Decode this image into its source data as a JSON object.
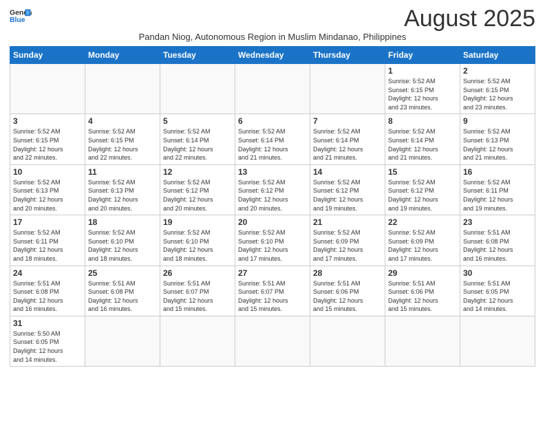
{
  "header": {
    "logo_line1": "General",
    "logo_line2": "Blue",
    "month_title": "August 2025",
    "subtitle": "Pandan Niog, Autonomous Region in Muslim Mindanao, Philippines"
  },
  "days_of_week": [
    "Sunday",
    "Monday",
    "Tuesday",
    "Wednesday",
    "Thursday",
    "Friday",
    "Saturday"
  ],
  "weeks": [
    [
      {
        "day": "",
        "info": ""
      },
      {
        "day": "",
        "info": ""
      },
      {
        "day": "",
        "info": ""
      },
      {
        "day": "",
        "info": ""
      },
      {
        "day": "",
        "info": ""
      },
      {
        "day": "1",
        "info": "Sunrise: 5:52 AM\nSunset: 6:15 PM\nDaylight: 12 hours\nand 23 minutes."
      },
      {
        "day": "2",
        "info": "Sunrise: 5:52 AM\nSunset: 6:15 PM\nDaylight: 12 hours\nand 23 minutes."
      }
    ],
    [
      {
        "day": "3",
        "info": "Sunrise: 5:52 AM\nSunset: 6:15 PM\nDaylight: 12 hours\nand 22 minutes."
      },
      {
        "day": "4",
        "info": "Sunrise: 5:52 AM\nSunset: 6:15 PM\nDaylight: 12 hours\nand 22 minutes."
      },
      {
        "day": "5",
        "info": "Sunrise: 5:52 AM\nSunset: 6:14 PM\nDaylight: 12 hours\nand 22 minutes."
      },
      {
        "day": "6",
        "info": "Sunrise: 5:52 AM\nSunset: 6:14 PM\nDaylight: 12 hours\nand 21 minutes."
      },
      {
        "day": "7",
        "info": "Sunrise: 5:52 AM\nSunset: 6:14 PM\nDaylight: 12 hours\nand 21 minutes."
      },
      {
        "day": "8",
        "info": "Sunrise: 5:52 AM\nSunset: 6:14 PM\nDaylight: 12 hours\nand 21 minutes."
      },
      {
        "day": "9",
        "info": "Sunrise: 5:52 AM\nSunset: 6:13 PM\nDaylight: 12 hours\nand 21 minutes."
      }
    ],
    [
      {
        "day": "10",
        "info": "Sunrise: 5:52 AM\nSunset: 6:13 PM\nDaylight: 12 hours\nand 20 minutes."
      },
      {
        "day": "11",
        "info": "Sunrise: 5:52 AM\nSunset: 6:13 PM\nDaylight: 12 hours\nand 20 minutes."
      },
      {
        "day": "12",
        "info": "Sunrise: 5:52 AM\nSunset: 6:12 PM\nDaylight: 12 hours\nand 20 minutes."
      },
      {
        "day": "13",
        "info": "Sunrise: 5:52 AM\nSunset: 6:12 PM\nDaylight: 12 hours\nand 20 minutes."
      },
      {
        "day": "14",
        "info": "Sunrise: 5:52 AM\nSunset: 6:12 PM\nDaylight: 12 hours\nand 19 minutes."
      },
      {
        "day": "15",
        "info": "Sunrise: 5:52 AM\nSunset: 6:12 PM\nDaylight: 12 hours\nand 19 minutes."
      },
      {
        "day": "16",
        "info": "Sunrise: 5:52 AM\nSunset: 6:11 PM\nDaylight: 12 hours\nand 19 minutes."
      }
    ],
    [
      {
        "day": "17",
        "info": "Sunrise: 5:52 AM\nSunset: 6:11 PM\nDaylight: 12 hours\nand 18 minutes."
      },
      {
        "day": "18",
        "info": "Sunrise: 5:52 AM\nSunset: 6:10 PM\nDaylight: 12 hours\nand 18 minutes."
      },
      {
        "day": "19",
        "info": "Sunrise: 5:52 AM\nSunset: 6:10 PM\nDaylight: 12 hours\nand 18 minutes."
      },
      {
        "day": "20",
        "info": "Sunrise: 5:52 AM\nSunset: 6:10 PM\nDaylight: 12 hours\nand 17 minutes."
      },
      {
        "day": "21",
        "info": "Sunrise: 5:52 AM\nSunset: 6:09 PM\nDaylight: 12 hours\nand 17 minutes."
      },
      {
        "day": "22",
        "info": "Sunrise: 5:52 AM\nSunset: 6:09 PM\nDaylight: 12 hours\nand 17 minutes."
      },
      {
        "day": "23",
        "info": "Sunrise: 5:51 AM\nSunset: 6:08 PM\nDaylight: 12 hours\nand 16 minutes."
      }
    ],
    [
      {
        "day": "24",
        "info": "Sunrise: 5:51 AM\nSunset: 6:08 PM\nDaylight: 12 hours\nand 16 minutes."
      },
      {
        "day": "25",
        "info": "Sunrise: 5:51 AM\nSunset: 6:08 PM\nDaylight: 12 hours\nand 16 minutes."
      },
      {
        "day": "26",
        "info": "Sunrise: 5:51 AM\nSunset: 6:07 PM\nDaylight: 12 hours\nand 15 minutes."
      },
      {
        "day": "27",
        "info": "Sunrise: 5:51 AM\nSunset: 6:07 PM\nDaylight: 12 hours\nand 15 minutes."
      },
      {
        "day": "28",
        "info": "Sunrise: 5:51 AM\nSunset: 6:06 PM\nDaylight: 12 hours\nand 15 minutes."
      },
      {
        "day": "29",
        "info": "Sunrise: 5:51 AM\nSunset: 6:06 PM\nDaylight: 12 hours\nand 15 minutes."
      },
      {
        "day": "30",
        "info": "Sunrise: 5:51 AM\nSunset: 6:05 PM\nDaylight: 12 hours\nand 14 minutes."
      }
    ],
    [
      {
        "day": "31",
        "info": "Sunrise: 5:50 AM\nSunset: 6:05 PM\nDaylight: 12 hours\nand 14 minutes."
      },
      {
        "day": "",
        "info": ""
      },
      {
        "day": "",
        "info": ""
      },
      {
        "day": "",
        "info": ""
      },
      {
        "day": "",
        "info": ""
      },
      {
        "day": "",
        "info": ""
      },
      {
        "day": "",
        "info": ""
      }
    ]
  ]
}
